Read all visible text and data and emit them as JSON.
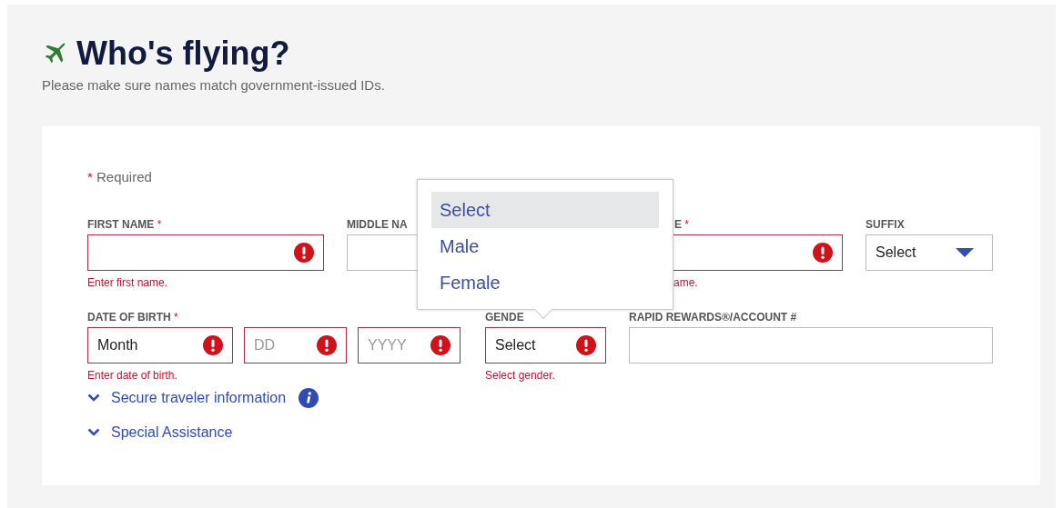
{
  "header": {
    "title": "Who's flying?",
    "subtitle": "Please make sure names match government-issued IDs."
  },
  "required_note": {
    "mark": "*",
    "text": "Required"
  },
  "rows": [
    [
      {
        "label": "FIRST NAME",
        "required": true,
        "error": "Enter first name.",
        "inputs": [
          {
            "kind": "text",
            "invalid": true
          }
        ]
      },
      {
        "label": "MIDDLE NA",
        "required": false,
        "inputs": [
          {
            "kind": "text",
            "invalid": false
          }
        ]
      },
      {
        "label": "E",
        "required": true,
        "error": "ame.",
        "inputs": [
          {
            "kind": "text",
            "invalid": true
          }
        ]
      },
      {
        "label": "SUFFIX",
        "required": false,
        "inputs": [
          {
            "kind": "select",
            "value": "Select",
            "invalid": false
          }
        ]
      }
    ],
    [
      {
        "label": "DATE OF BIRTH",
        "required": true,
        "error": "Enter date of birth.",
        "inputs": [
          {
            "kind": "select",
            "value": "Month",
            "invalid": true
          },
          {
            "kind": "text",
            "placeholder": "DD",
            "invalid": true
          },
          {
            "kind": "text",
            "placeholder": "YYYY",
            "invalid": true
          }
        ]
      },
      {
        "label": "GENDE",
        "required": false,
        "error": "Select gender.",
        "inputs": [
          {
            "kind": "select",
            "value": "Select",
            "invalid": true
          }
        ]
      },
      {
        "label": "RAPID REWARDS®/ACCOUNT #",
        "required": false,
        "inputs": [
          {
            "kind": "text",
            "invalid": false
          }
        ]
      }
    ]
  ],
  "links": [
    {
      "label": "Secure traveler information",
      "info": true
    },
    {
      "label": "Special Assistance",
      "info": false
    }
  ],
  "dropdown": {
    "options": [
      {
        "label": "Select",
        "selected": true
      },
      {
        "label": "Male",
        "selected": false
      },
      {
        "label": "Female",
        "selected": false
      }
    ]
  }
}
